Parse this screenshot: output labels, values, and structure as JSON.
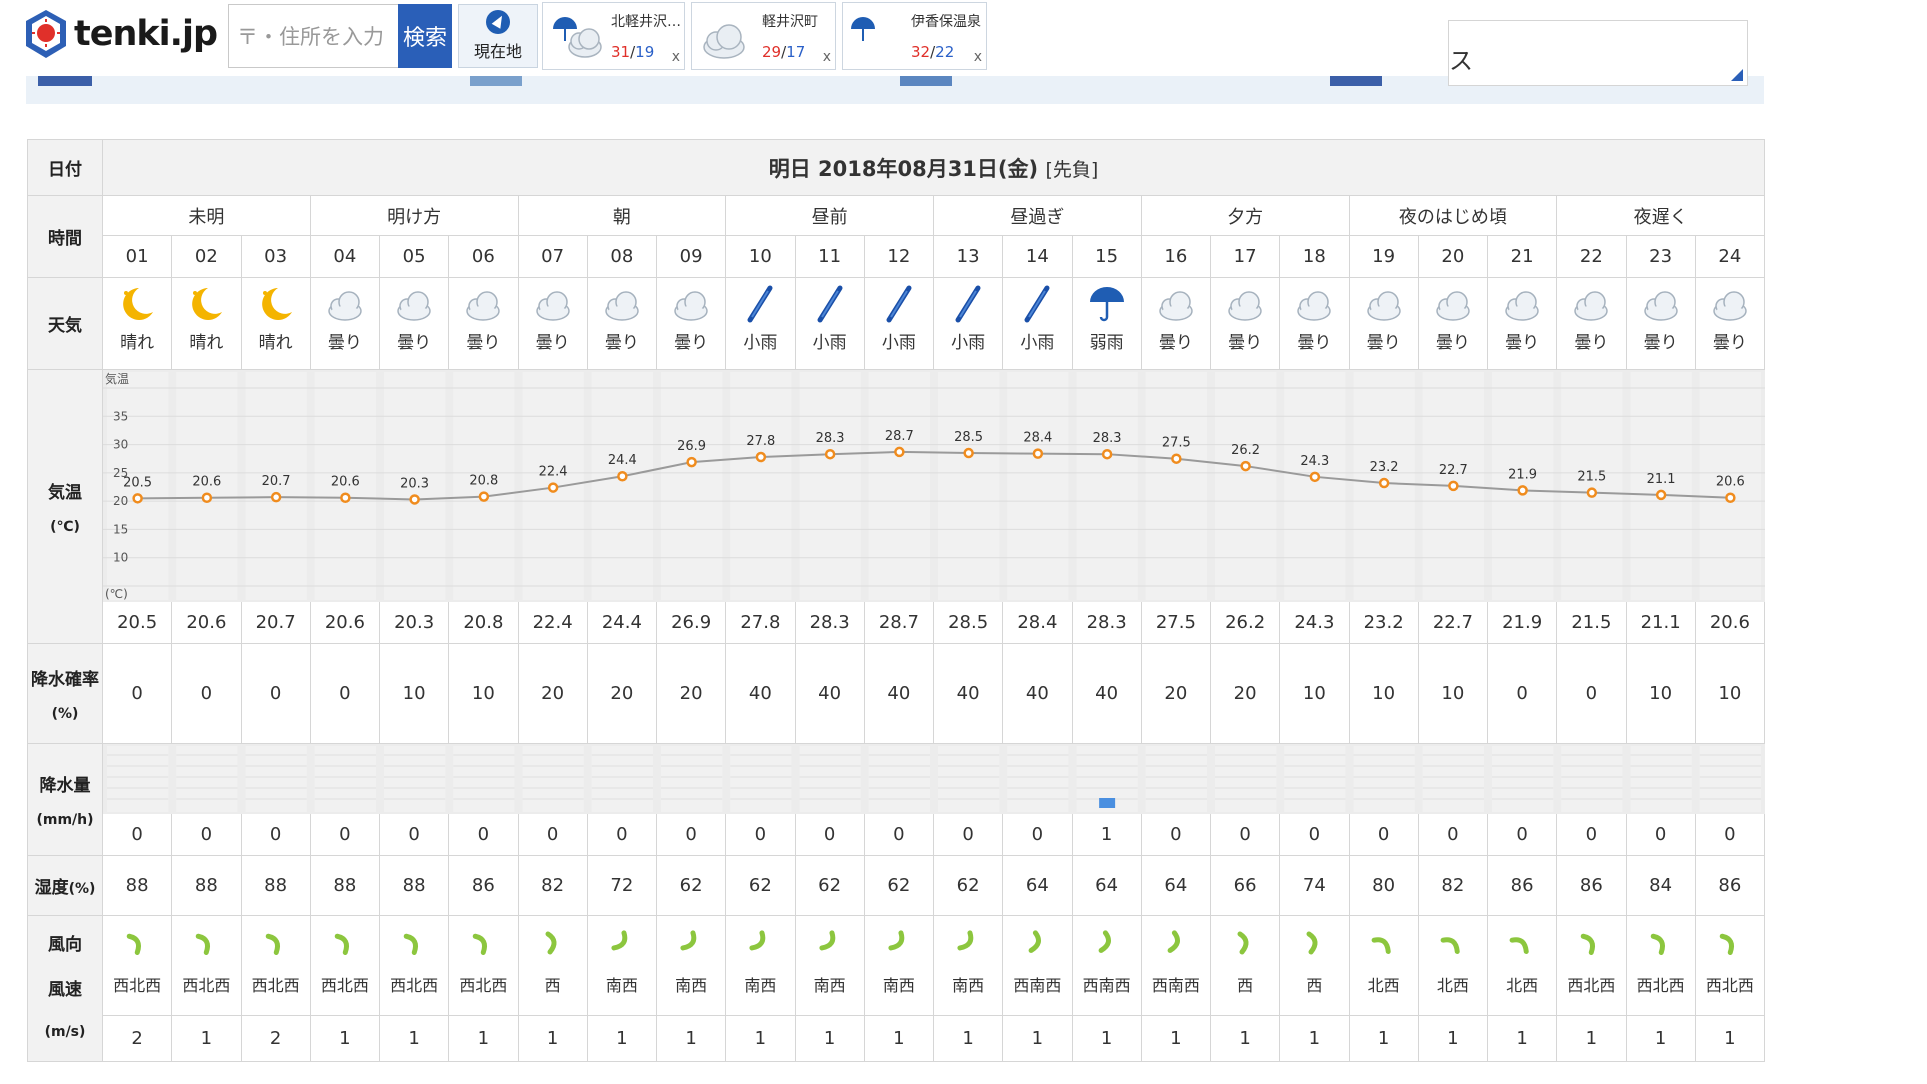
{
  "header": {
    "logo_text": "tenki.jp",
    "search_placeholder": "〒・住所を入力",
    "search_button": "検索",
    "gps_label": "現在地",
    "recent": [
      {
        "name": "北軽井沢…",
        "high": "31",
        "low": "19",
        "icon": "umbrella-cloud-icon"
      },
      {
        "name": "軽井沢町",
        "high": "29",
        "low": "17",
        "icon": "cloud-icon"
      },
      {
        "name": "伊香保温泉",
        "high": "32",
        "low": "22",
        "icon": "moon-umbrella-icon"
      }
    ],
    "close_label": "x",
    "ad_text": "ス"
  },
  "table": {
    "date_label": "日付",
    "date_value": "明日 2018年08月31日(金)",
    "rokuyo": "[先負]",
    "time_label": "時間",
    "weather_label": "天気",
    "temp_label": "気温",
    "temp_unit": "(℃)",
    "precip_prob_label": "降水確率",
    "precip_prob_unit": "(%)",
    "precip_amount_label": "降水量",
    "precip_amount_unit": "(mm/h)",
    "humidity_label": "湿度",
    "humidity_unit": "(%)",
    "wind_dir_label": "風向",
    "wind_speed_label": "風速",
    "wind_unit": "(m/s)",
    "periods": [
      {
        "label": "未明",
        "span": 3
      },
      {
        "label": "明け方",
        "span": 3
      },
      {
        "label": "朝",
        "span": 3
      },
      {
        "label": "昼前",
        "span": 3
      },
      {
        "label": "昼過ぎ",
        "span": 3
      },
      {
        "label": "夕方",
        "span": 3
      },
      {
        "label": "夜のはじめ頃",
        "span": 3
      },
      {
        "label": "夜遅く",
        "span": 3
      }
    ],
    "hours": [
      "01",
      "02",
      "03",
      "04",
      "05",
      "06",
      "07",
      "08",
      "09",
      "10",
      "11",
      "12",
      "13",
      "14",
      "15",
      "16",
      "17",
      "18",
      "19",
      "20",
      "21",
      "22",
      "23",
      "24"
    ],
    "weather": [
      "晴れ",
      "晴れ",
      "晴れ",
      "曇り",
      "曇り",
      "曇り",
      "曇り",
      "曇り",
      "曇り",
      "小雨",
      "小雨",
      "小雨",
      "小雨",
      "小雨",
      "弱雨",
      "曇り",
      "曇り",
      "曇り",
      "曇り",
      "曇り",
      "曇り",
      "曇り",
      "曇り",
      "曇り"
    ],
    "weather_icons": [
      "moon-icon",
      "moon-icon",
      "moon-icon",
      "cloud-icon",
      "cloud-icon",
      "cloud-icon",
      "cloud-icon",
      "cloud-icon",
      "cloud-icon",
      "umbrella-closed-icon",
      "umbrella-closed-icon",
      "umbrella-closed-icon",
      "umbrella-closed-icon",
      "umbrella-closed-icon",
      "umbrella-open-icon",
      "cloud-icon",
      "cloud-icon",
      "cloud-icon",
      "cloud-icon",
      "cloud-icon",
      "cloud-icon",
      "cloud-icon",
      "cloud-icon",
      "cloud-icon"
    ],
    "temps": [
      "20.5",
      "20.6",
      "20.7",
      "20.6",
      "20.3",
      "20.8",
      "22.4",
      "24.4",
      "26.9",
      "27.8",
      "28.3",
      "28.7",
      "28.5",
      "28.4",
      "28.3",
      "27.5",
      "26.2",
      "24.3",
      "23.2",
      "22.7",
      "21.9",
      "21.5",
      "21.1",
      "20.6"
    ],
    "precip_prob": [
      "0",
      "0",
      "0",
      "0",
      "10",
      "10",
      "20",
      "20",
      "20",
      "40",
      "40",
      "40",
      "40",
      "40",
      "40",
      "20",
      "20",
      "10",
      "10",
      "10",
      "0",
      "0",
      "10",
      "10"
    ],
    "precip_amount": [
      "0",
      "0",
      "0",
      "0",
      "0",
      "0",
      "0",
      "0",
      "0",
      "0",
      "0",
      "0",
      "0",
      "0",
      "1",
      "0",
      "0",
      "0",
      "0",
      "0",
      "0",
      "0",
      "0",
      "0"
    ],
    "humidity": [
      "88",
      "88",
      "88",
      "88",
      "88",
      "86",
      "82",
      "72",
      "62",
      "62",
      "62",
      "62",
      "62",
      "64",
      "64",
      "64",
      "66",
      "74",
      "80",
      "82",
      "86",
      "86",
      "84",
      "86"
    ],
    "wind_dir": [
      "西北西",
      "西北西",
      "西北西",
      "西北西",
      "西北西",
      "西北西",
      "西",
      "南西",
      "南西",
      "南西",
      "南西",
      "南西",
      "南西",
      "西南西",
      "西南西",
      "西南西",
      "西",
      "西",
      "北西",
      "北西",
      "北西",
      "西北西",
      "西北西",
      "西北西"
    ],
    "wind_speed": [
      "2",
      "1",
      "2",
      "1",
      "1",
      "1",
      "1",
      "1",
      "1",
      "1",
      "1",
      "1",
      "1",
      "1",
      "1",
      "1",
      "1",
      "1",
      "1",
      "1",
      "1",
      "1",
      "1",
      "1"
    ]
  },
  "chart_data": {
    "type": "line",
    "x": [
      "01",
      "02",
      "03",
      "04",
      "05",
      "06",
      "07",
      "08",
      "09",
      "10",
      "11",
      "12",
      "13",
      "14",
      "15",
      "16",
      "17",
      "18",
      "19",
      "20",
      "21",
      "22",
      "23",
      "24"
    ],
    "series": [
      {
        "values": [
          20.5,
          20.6,
          20.7,
          20.6,
          20.3,
          20.8,
          22.4,
          24.4,
          26.9,
          27.8,
          28.3,
          28.7,
          28.5,
          28.4,
          28.3,
          27.5,
          26.2,
          24.3,
          23.2,
          22.7,
          21.9,
          21.5,
          21.1,
          20.6
        ]
      }
    ],
    "y_axis_title": "気温",
    "y_axis_unit": "(℃)",
    "y_ticks": [
      "35",
      "30",
      "25",
      "20",
      "15",
      "10"
    ],
    "ylim": [
      5,
      40
    ],
    "grid": true,
    "line_color": "#9a9a9a",
    "marker_color": "#f08c1e"
  },
  "colors": {
    "accent": "#2a5fb8",
    "high_temp": "#e0302a",
    "low_temp": "#2a60c8",
    "wind_arrow": "#8cc63e",
    "rain_bar": "#4a8fe0"
  }
}
